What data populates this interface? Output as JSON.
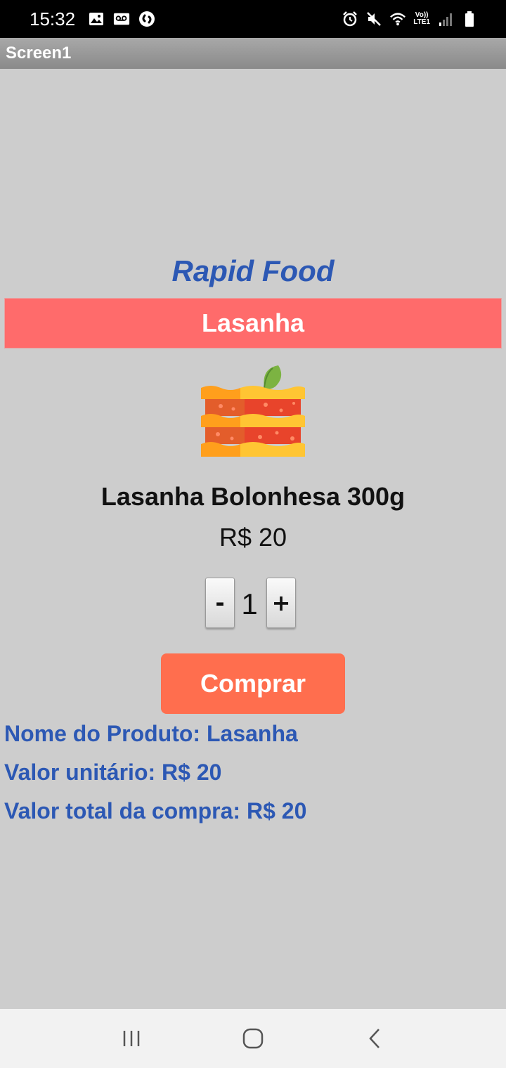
{
  "status_bar": {
    "time": "15:32",
    "network_label_top": "Vo))",
    "network_label_bottom": "LTE1",
    "icons_left": [
      "gallery-icon",
      "voicemail-icon",
      "shazam-icon"
    ],
    "icons_right": [
      "alarm-icon",
      "mute-icon",
      "wifi-icon",
      "lte-icon",
      "signal-icon",
      "battery-icon"
    ]
  },
  "app": {
    "title": "Screen1"
  },
  "main": {
    "brand": "Rapid Food",
    "category_banner": "Lasanha",
    "product_image": "lasagna-icon",
    "product_name": "Lasanha Bolonhesa 300g",
    "product_price": "R$ 20",
    "quantity": {
      "minus_label": "-",
      "value": "1",
      "plus_label": "+"
    },
    "buy_button": "Comprar",
    "summary": {
      "product_name": "Nome do Produto: Lasanha",
      "unit_value": "Valor unitário: R$ 20",
      "total_value": "Valor total da compra: R$ 20"
    }
  },
  "nav_bar": {
    "icons": [
      "recent-apps-icon",
      "home-icon",
      "back-icon"
    ]
  },
  "colors": {
    "background": "#cdcdcd",
    "brand_blue": "#2c58b4",
    "banner_red": "#ff6b6b",
    "buy_orange": "#ff6e4e"
  }
}
